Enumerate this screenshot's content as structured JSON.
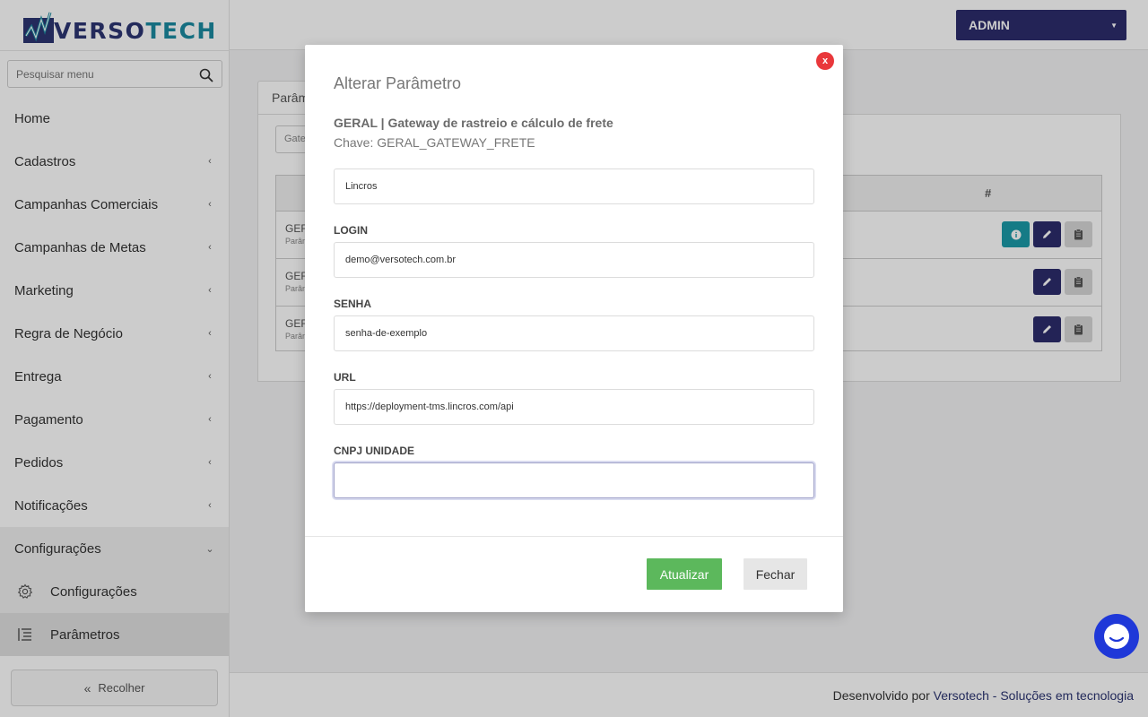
{
  "brand": {
    "logo_main": "VERSO",
    "logo_accent": "TECH"
  },
  "search": {
    "placeholder": "Pesquisar menu"
  },
  "sidebar": {
    "items": [
      {
        "label": "Home"
      },
      {
        "label": "Cadastros"
      },
      {
        "label": "Campanhas Comerciais"
      },
      {
        "label": "Campanhas de Metas"
      },
      {
        "label": "Marketing"
      },
      {
        "label": "Regra de Negócio"
      },
      {
        "label": "Entrega"
      },
      {
        "label": "Pagamento"
      },
      {
        "label": "Pedidos"
      },
      {
        "label": "Notificações"
      },
      {
        "label": "Configurações"
      }
    ],
    "subitems": [
      {
        "label": "Configurações",
        "icon": "gear-icon"
      },
      {
        "label": "Parâmetros",
        "icon": "list-icon"
      }
    ],
    "collapse_label": "Recolher"
  },
  "header": {
    "user_menu": "ADMIN"
  },
  "background": {
    "tab_label": "Parâm",
    "filter_text": "Gate",
    "table_header_hash": "#",
    "rows": [
      {
        "title": "GER",
        "subtitle": "Parâm"
      },
      {
        "title": "GER",
        "subtitle": "Parâm"
      },
      {
        "title": "GER",
        "subtitle": "Parâm"
      }
    ]
  },
  "modal": {
    "close_label": "x",
    "title": "Alterar Parâmetro",
    "subtitle": "GERAL | Gateway de rastreio e cálculo de frete",
    "key": "Chave: GERAL_GATEWAY_FRETE",
    "fields": [
      {
        "label": "",
        "value": "Lincros"
      },
      {
        "label": "LOGIN",
        "value": "demo@versotech.com.br"
      },
      {
        "label": "SENHA",
        "value": "senha-de-exemplo"
      },
      {
        "label": "URL",
        "value": "https://deployment-tms.lincros.com/api"
      },
      {
        "label": "CNPJ UNIDADE",
        "value": ""
      }
    ],
    "update_button": "Atualizar",
    "close_button": "Fechar"
  },
  "footer": {
    "prefix": "Desenvolvido por",
    "brand": "Versotech - Soluções em tecnologia"
  },
  "colors": {
    "primary": "#2c2c6c",
    "accent": "#1b9aa8",
    "success": "#5cb85c",
    "danger": "#e9383b",
    "chat": "#1f38d8"
  }
}
